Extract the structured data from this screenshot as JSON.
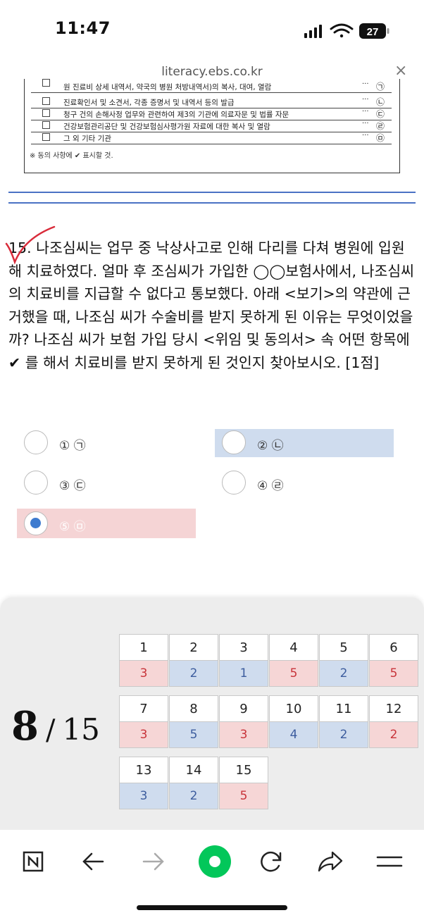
{
  "status": {
    "time": "11:47",
    "battery": "27"
  },
  "url_bar": {
    "url": "literacy.ebs.co.kr",
    "close": "×"
  },
  "document": {
    "rows": [
      {
        "text": "원 진료비 상세 내역서, 약국의 병원 처방내역서)의 복사, 대여, 열람",
        "mark": "㉠"
      },
      {
        "text": "진료확인서 및 소견서, 각종 증명서 및 내역서 등의 발급",
        "mark": "㉡"
      },
      {
        "text": "청구 건의 손해사정 업무와 관련하여 제3의 기관에 의료자문 및 법률 자문",
        "mark": "㉢"
      },
      {
        "text": "건강보험관리공단 및 건강보험심사평가원 자료에 대한 복사 및 열람",
        "mark": "㉣"
      },
      {
        "text": "그 외 기타 기관",
        "mark": "㉤"
      }
    ],
    "dots": "···",
    "note": "※ 동의 사항에 ✔ 표시할 것."
  },
  "question": {
    "text": "15. 나조심씨는 업무 중 낙상사고로 인해 다리를 다쳐 병원에 입원해 치료하였다. 얼마 후 조심씨가 가입한 ◯◯보험사에서, 나조심씨의 치료비를 지급할 수 없다고 통보했다. 아래 <보기>의 약관에 근거했을 때, 나조심 씨가 수술비를 받지 못하게 된 이유는 무엇이었을까? 나조심 씨가 보험 가입 당시 <위임 및 동의서> 속 어떤 항목에 ✔ 를 해서 치료비를 받지 못하게 된 것인지 찾아보시오. [1점]"
  },
  "options": [
    {
      "label": "① ㉠"
    },
    {
      "label": "② ㉡"
    },
    {
      "label": "③ ㉢"
    },
    {
      "label": "④ ㉣"
    },
    {
      "label": "⑤ ㉤"
    }
  ],
  "page_counter": {
    "current": "8",
    "slash": "/",
    "total": "15"
  },
  "answers": [
    {
      "num": "1",
      "val": "3",
      "color": "red"
    },
    {
      "num": "2",
      "val": "2",
      "color": "blue"
    },
    {
      "num": "3",
      "val": "1",
      "color": "blue"
    },
    {
      "num": "4",
      "val": "5",
      "color": "red"
    },
    {
      "num": "5",
      "val": "2",
      "color": "blue"
    },
    {
      "num": "6",
      "val": "5",
      "color": "red"
    },
    {
      "num": "7",
      "val": "3",
      "color": "red"
    },
    {
      "num": "8",
      "val": "5",
      "color": "blue"
    },
    {
      "num": "9",
      "val": "3",
      "color": "red"
    },
    {
      "num": "10",
      "val": "4",
      "color": "blue"
    },
    {
      "num": "11",
      "val": "2",
      "color": "blue"
    },
    {
      "num": "12",
      "val": "2",
      "color": "red"
    },
    {
      "num": "13",
      "val": "3",
      "color": "blue"
    },
    {
      "num": "14",
      "val": "2",
      "color": "blue"
    },
    {
      "num": "15",
      "val": "5",
      "color": "red"
    }
  ],
  "toolbar_icons": [
    "naver-logo-icon",
    "back-arrow-icon",
    "forward-arrow-icon",
    "green-dot-icon",
    "refresh-icon",
    "share-icon",
    "menu-icon"
  ],
  "colors": {
    "selected_blue": "#cfdcee",
    "selected_red": "#f5d4d5",
    "accent_green": "#03c75a",
    "radio_fill": "#3e7bcf"
  }
}
